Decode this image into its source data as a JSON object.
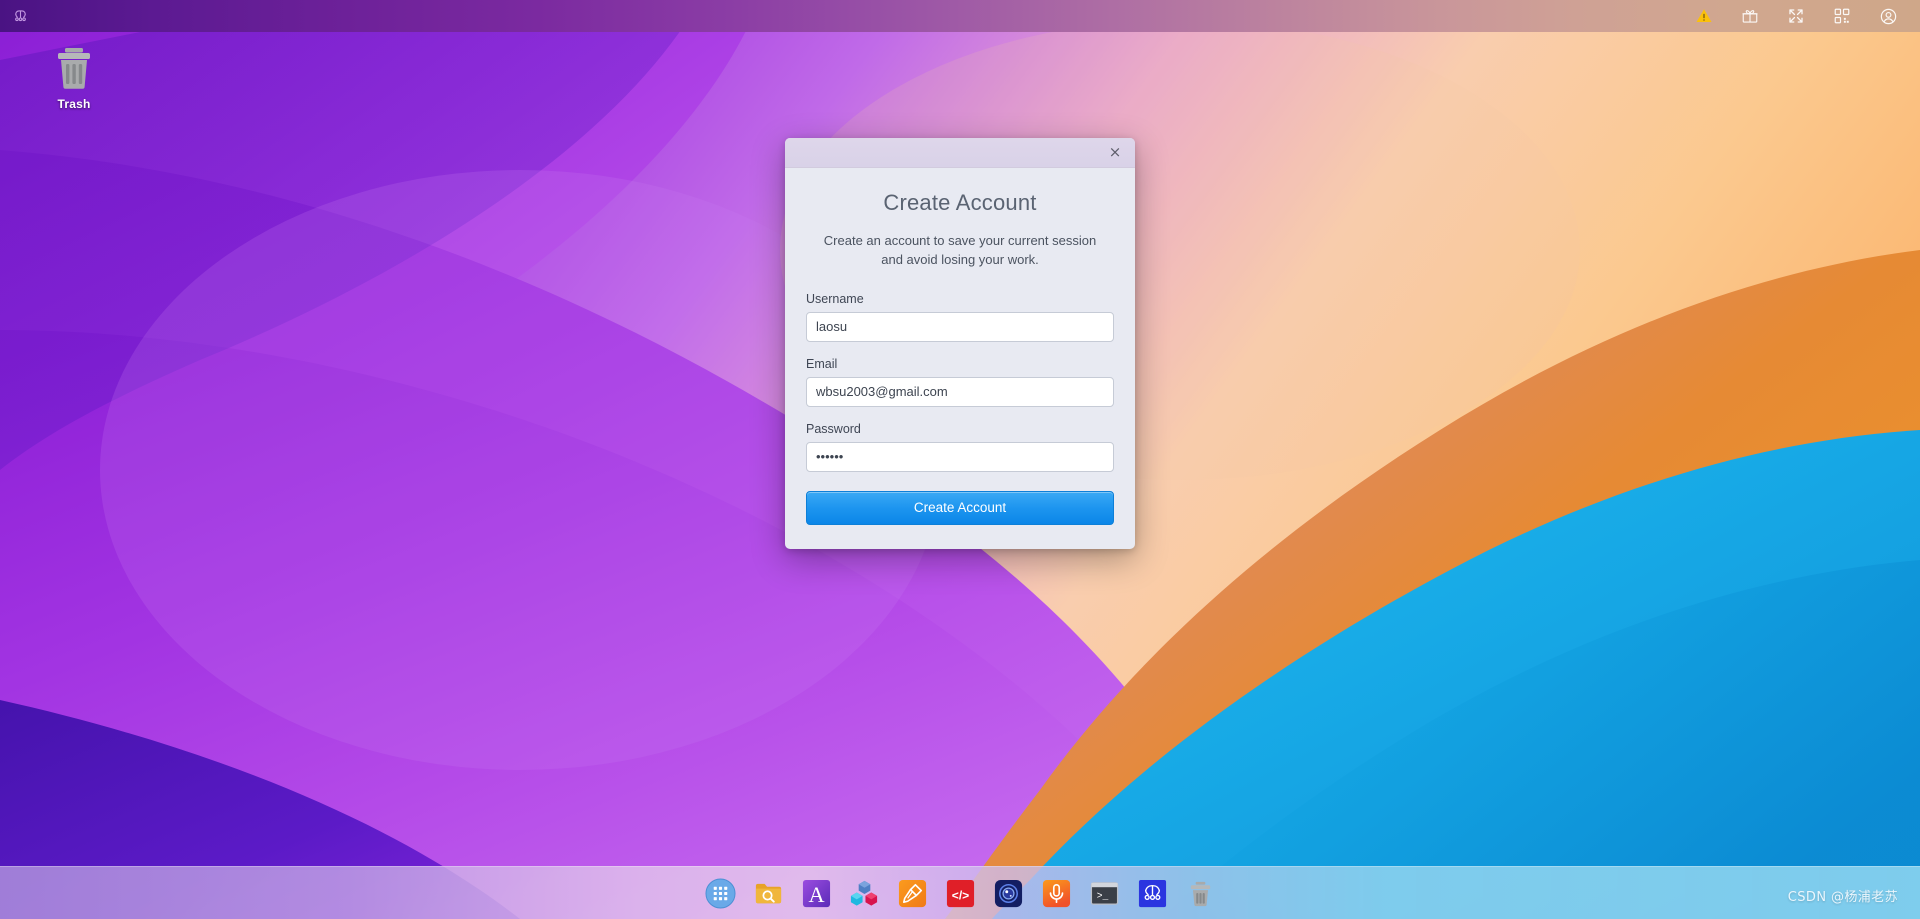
{
  "topbar": {
    "left_icons": [
      {
        "name": "network-topology-icon",
        "glyph": "network"
      }
    ],
    "right_icons": [
      {
        "name": "warning-icon",
        "glyph": "warning",
        "color": "#ffc400"
      },
      {
        "name": "gift-icon",
        "glyph": "gift",
        "color": "#ffffff"
      },
      {
        "name": "fullscreen-icon",
        "glyph": "fullscreen",
        "color": "#ffffff"
      },
      {
        "name": "qr-code-icon",
        "glyph": "qrcode",
        "color": "#ffffff"
      },
      {
        "name": "account-icon",
        "glyph": "account",
        "color": "#ffffff"
      }
    ]
  },
  "desktop": {
    "icons": [
      {
        "name": "trash-desktop-icon",
        "label": "Trash"
      }
    ]
  },
  "dialog": {
    "title": "Create Account",
    "subtitle": "Create an account to save your current session and avoid losing your work.",
    "close_label": "×",
    "fields": [
      {
        "name": "username",
        "label": "Username",
        "value": "laosu",
        "placeholder": "Username",
        "type": "text"
      },
      {
        "name": "email",
        "label": "Email",
        "value": "wbsu2003@gmail.com",
        "placeholder": "Email",
        "type": "text"
      },
      {
        "name": "password",
        "label": "Password",
        "value": "••••••",
        "placeholder": "Password",
        "type": "text"
      }
    ],
    "submit_label": "Create Account",
    "accent_color": "#1d95ef"
  },
  "dock": {
    "items": [
      {
        "name": "dock-item-app-launcher",
        "glyph": "launcher",
        "label": "Applications"
      },
      {
        "name": "dock-item-file-search",
        "glyph": "folder-search",
        "label": "File Search"
      },
      {
        "name": "dock-item-fonts",
        "glyph": "letter-a",
        "label": "Fonts"
      },
      {
        "name": "dock-item-blocks",
        "glyph": "blocks",
        "label": "Blocks"
      },
      {
        "name": "dock-item-paint",
        "glyph": "paint-brush",
        "label": "Paint"
      },
      {
        "name": "dock-item-code",
        "glyph": "code-tags",
        "label": "Code"
      },
      {
        "name": "dock-item-camera",
        "glyph": "camera-disc",
        "label": "Camera"
      },
      {
        "name": "dock-item-microphone",
        "glyph": "microphone",
        "label": "Microphone"
      },
      {
        "name": "dock-item-terminal",
        "glyph": "terminal",
        "label": "Terminal"
      },
      {
        "name": "dock-item-network",
        "glyph": "network",
        "label": "Network"
      },
      {
        "name": "dock-item-trash",
        "glyph": "trash",
        "label": "Trash"
      }
    ]
  },
  "watermark": {
    "text": "CSDN @杨浦老苏"
  },
  "wallpaper": {
    "colors": {
      "purple_dark": "#3a0f9e",
      "purple": "#9a2bdf",
      "purple_light": "#c06ae8",
      "pink": "#f0b8c8",
      "peach": "#fbd0a8",
      "orange": "#e8861f",
      "cyan": "#21b6e8",
      "blue": "#1199d8"
    }
  }
}
